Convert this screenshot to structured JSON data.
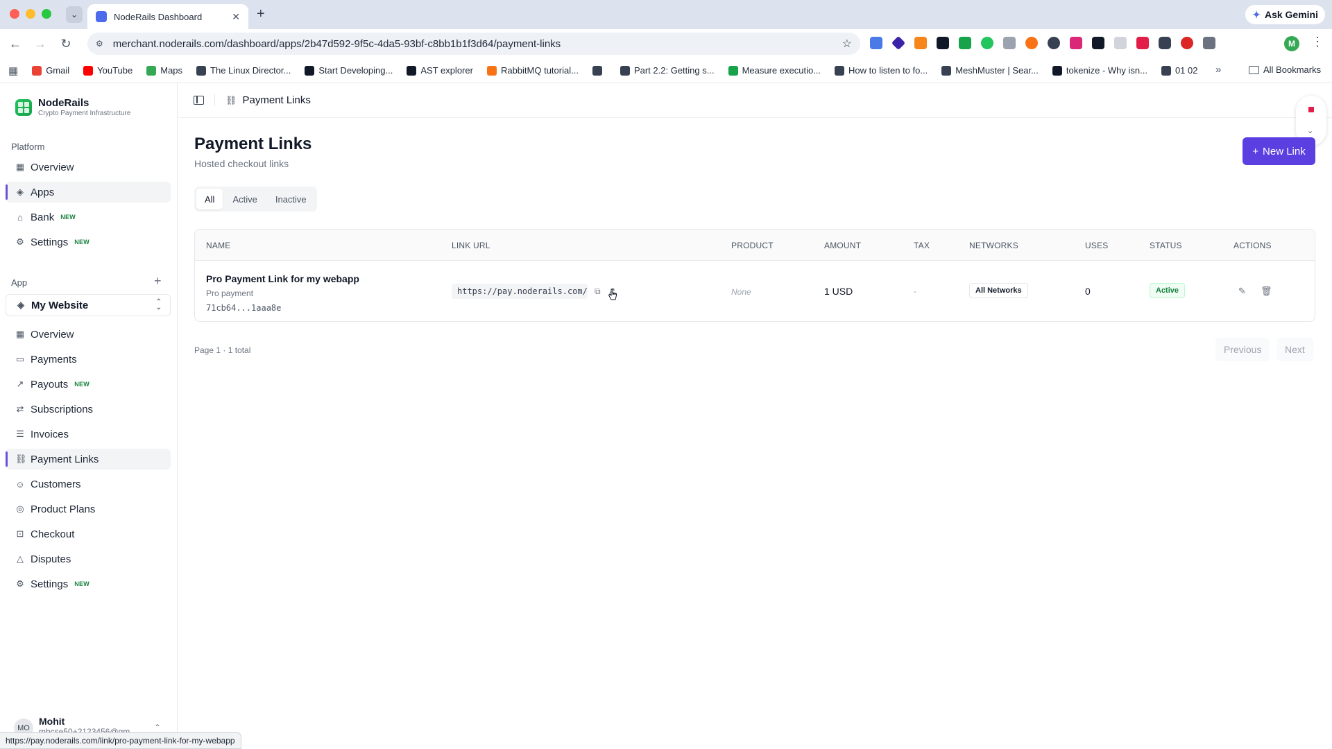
{
  "browser": {
    "tab_title": "NodeRails Dashboard",
    "tab_close": "✕",
    "new_tab": "+",
    "gemini_label": "Ask Gemini",
    "url": "merchant.noderails.com/dashboard/apps/2b47d592-9f5c-4da5-93bf-c8bb1b1f3d64/payment-links",
    "profile_initial": "M",
    "bookmarks": [
      {
        "label": "Gmail",
        "color": "#ea4335"
      },
      {
        "label": "YouTube",
        "color": "#ff0000"
      },
      {
        "label": "Maps",
        "color": "#34a853"
      },
      {
        "label": "The Linux Director...",
        "color": "#374151"
      },
      {
        "label": "Start Developing...",
        "color": "#111827"
      },
      {
        "label": "AST explorer",
        "color": "#111827"
      },
      {
        "label": "RabbitMQ tutorial...",
        "color": "#f97316"
      },
      {
        "label": "",
        "color": "#374151"
      },
      {
        "label": "Part 2.2: Getting s...",
        "color": "#374151"
      },
      {
        "label": "Measure executio...",
        "color": "#16a34a"
      },
      {
        "label": "How to listen to fo...",
        "color": "#374151"
      },
      {
        "label": "MeshMuster | Sear...",
        "color": "#374151"
      },
      {
        "label": "tokenize - Why isn...",
        "color": "#111827"
      },
      {
        "label": "01 02",
        "color": "#374151"
      }
    ],
    "all_bookmarks": "All Bookmarks",
    "status_url": "https://pay.noderails.com/link/pro-payment-link-for-my-webapp"
  },
  "sidebar": {
    "brand_name": "NodeRails",
    "brand_sub": "Crypto Payment Infrastructure",
    "platform_label": "Platform",
    "platform_items": [
      {
        "label": "Overview",
        "icon": "▦",
        "badge": ""
      },
      {
        "label": "Apps",
        "icon": "◈",
        "badge": ""
      },
      {
        "label": "Bank",
        "icon": "⌂",
        "badge": "NEW"
      },
      {
        "label": "Settings",
        "icon": "⚙",
        "badge": "NEW"
      }
    ],
    "app_label": "App",
    "app_add": "+",
    "app_selected": "My Website",
    "app_items": [
      {
        "label": "Overview",
        "icon": "▦",
        "badge": ""
      },
      {
        "label": "Payments",
        "icon": "▭",
        "badge": ""
      },
      {
        "label": "Payouts",
        "icon": "↗",
        "badge": "NEW"
      },
      {
        "label": "Subscriptions",
        "icon": "⇄",
        "badge": ""
      },
      {
        "label": "Invoices",
        "icon": "☰",
        "badge": ""
      },
      {
        "label": "Payment Links",
        "icon": "⛓",
        "badge": ""
      },
      {
        "label": "Customers",
        "icon": "☺",
        "badge": ""
      },
      {
        "label": "Product Plans",
        "icon": "◎",
        "badge": ""
      },
      {
        "label": "Checkout",
        "icon": "⊡",
        "badge": ""
      },
      {
        "label": "Disputes",
        "icon": "△",
        "badge": ""
      },
      {
        "label": "Settings",
        "icon": "⚙",
        "badge": "NEW"
      }
    ],
    "user_initials": "MO",
    "user_name": "Mohit",
    "user_email": "mbcse50+2123456@gm"
  },
  "main": {
    "breadcrumb": "Payment Links",
    "title": "Payment Links",
    "subtitle": "Hosted checkout links",
    "new_link_label": "New Link",
    "filters": [
      "All",
      "Active",
      "Inactive"
    ],
    "columns": {
      "name": "NAME",
      "link_url": "LINK URL",
      "product": "PRODUCT",
      "amount": "AMOUNT",
      "tax": "TAX",
      "networks": "NETWORKS",
      "uses": "USES",
      "status": "STATUS",
      "actions": "ACTIONS"
    },
    "rows": [
      {
        "name": "Pro Payment Link for my webapp",
        "description": "Pro payment",
        "id": "71cb64...1aaa8e",
        "link_url": "https://pay.noderails.com/link/pro-payment-link-for-my-webapp",
        "product": "None",
        "amount": "1 USD",
        "tax": "-",
        "networks": "All Networks",
        "uses": "0",
        "status": "Active"
      }
    ],
    "pager_info": "Page 1 · 1 total",
    "previous_label": "Previous",
    "next_label": "Next"
  },
  "colors": {
    "accent": "#5b3fe0",
    "active_status": "#15803d",
    "new_badge": "#15803d"
  }
}
